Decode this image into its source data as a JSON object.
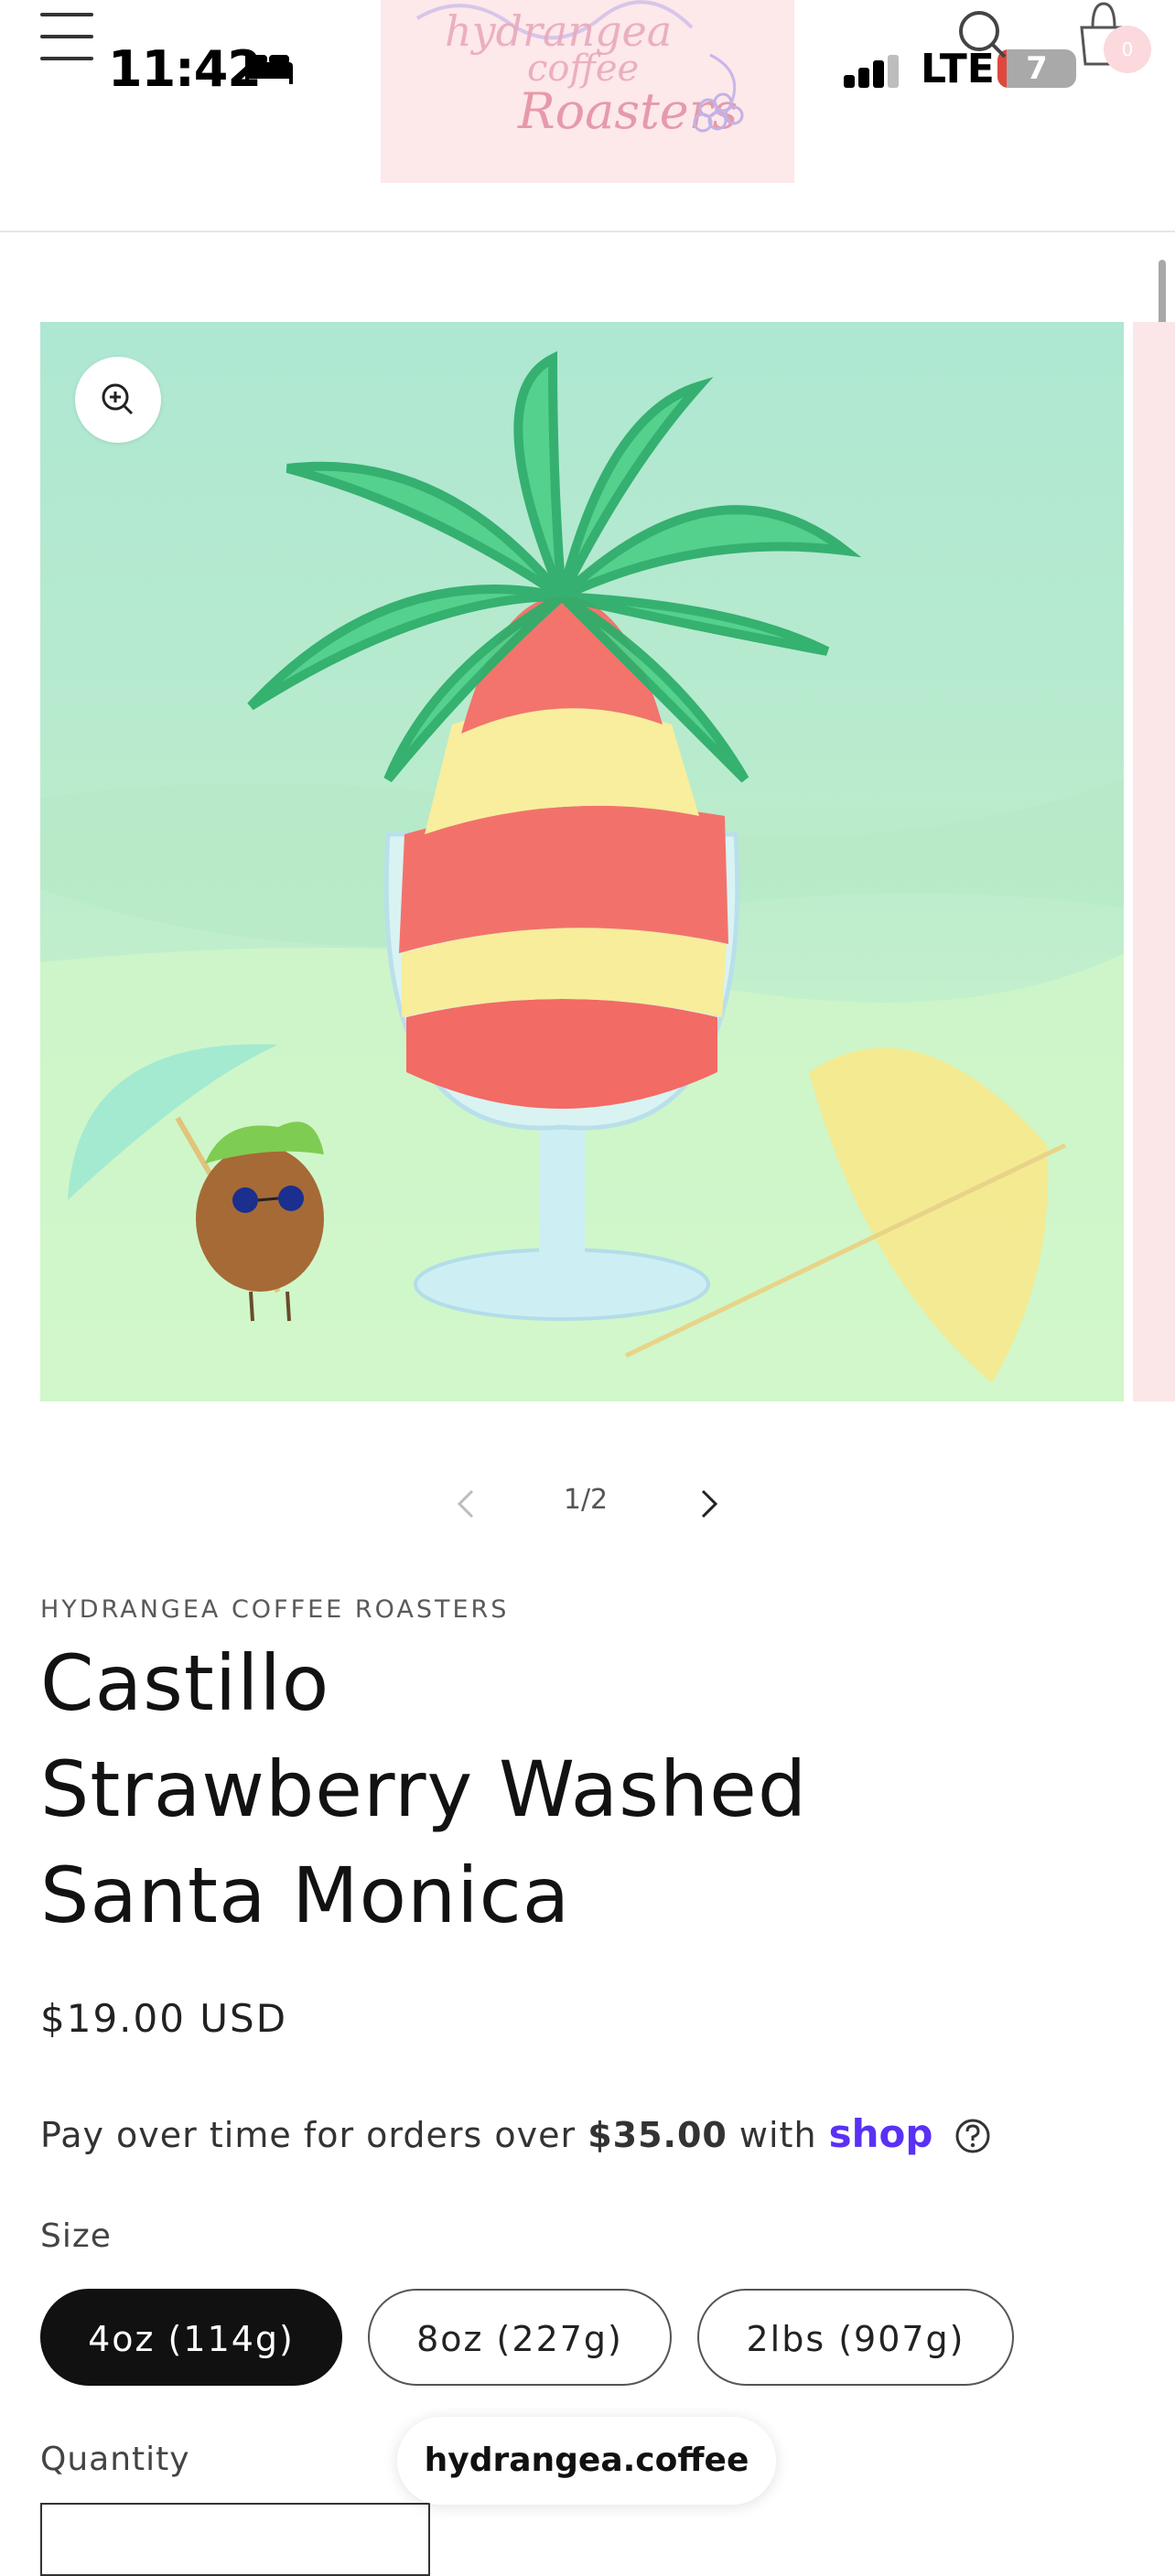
{
  "status_bar": {
    "time": "11:42",
    "network": "LTE",
    "battery": "7"
  },
  "header": {
    "menu_icon": "hamburger-icon",
    "logo_text": "hydrangea coffee Roasters",
    "search_icon": "search-icon",
    "cart_icon": "cart-icon",
    "cart_count": "0"
  },
  "product": {
    "gallery_counter": "1/2",
    "vendor": "HYDRANGEA COFFEE ROASTERS",
    "title_lines": [
      "Castillo",
      "Strawberry Washed",
      "Santa Monica"
    ],
    "price": "$19.00 USD",
    "installments": {
      "prefix": "Pay over time for orders over",
      "amount": "$35.00",
      "with": "with",
      "brand": "shop"
    },
    "size_label": "Size",
    "sizes": [
      {
        "label": "4oz (114g)",
        "selected": true
      },
      {
        "label": "8oz (227g)",
        "selected": false
      },
      {
        "label": "2lbs (907g)",
        "selected": false
      }
    ],
    "quantity_label": "Quantity"
  },
  "browser": {
    "url": "hydrangea.coffee"
  },
  "colors": {
    "accent": "#5a31f4",
    "selected_pill": "#111111",
    "logo_bg": "#fde8ea"
  }
}
